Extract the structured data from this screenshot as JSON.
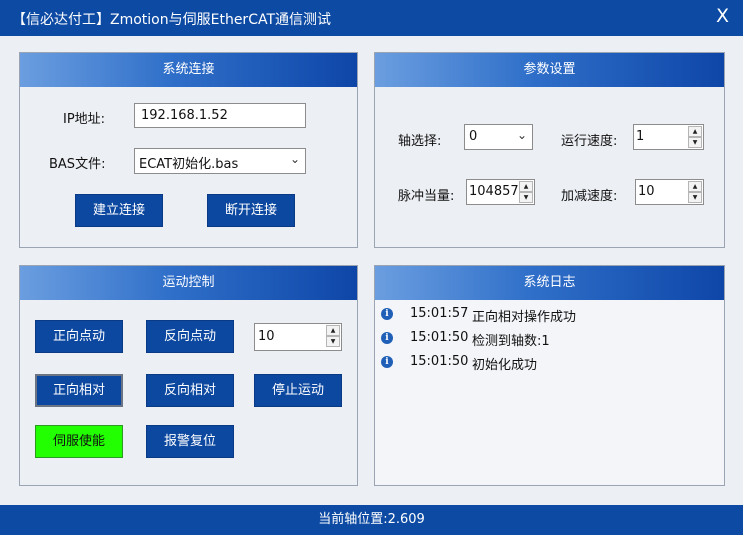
{
  "window": {
    "title": "【信必达付工】Zmotion与伺服EtherCAT通信测试",
    "close_label": "X"
  },
  "connection": {
    "header": "系统连接",
    "ip_label": "IP地址:",
    "ip_value": "192.168.1.52",
    "bas_label": "BAS文件:",
    "bas_value": "ECAT初始化.bas",
    "connect_label": "建立连接",
    "disconnect_label": "断开连接"
  },
  "params": {
    "header": "参数设置",
    "axis_label": "轴选择:",
    "axis_value": "0",
    "speed_label": "运行速度:",
    "speed_value": "1",
    "pulse_label": "脉冲当量:",
    "pulse_value": "104857",
    "accel_label": "加减速度:",
    "accel_value": "10"
  },
  "motion": {
    "header": "运动控制",
    "jog_fwd_label": "正向点动",
    "jog_rev_label": "反向点动",
    "distance_value": "10",
    "rel_fwd_label": "正向相对",
    "rel_rev_label": "反向相对",
    "stop_label": "停止运动",
    "servo_enable_label": "伺服使能",
    "alarm_reset_label": "报警复位",
    "servo_enable_color": "#22ff00"
  },
  "log": {
    "header": "系统日志",
    "entries": [
      {
        "time": "15:01:57",
        "message": "正向相对操作成功"
      },
      {
        "time": "15:01:50",
        "message": "检测到轴数:1"
      },
      {
        "time": "15:01:50",
        "message": "初始化成功"
      }
    ]
  },
  "status": {
    "position_text": "当前轴位置:2.609"
  },
  "colors": {
    "accent": "#0d4aa3",
    "button": "#0c48a0"
  }
}
